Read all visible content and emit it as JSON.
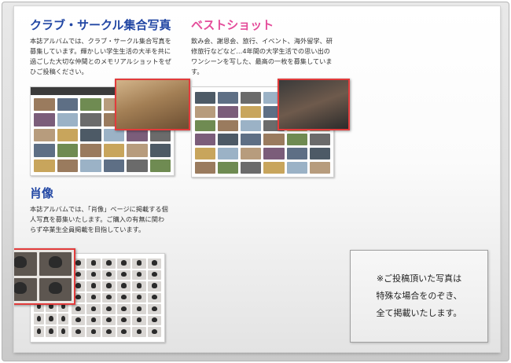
{
  "sections": {
    "club": {
      "title": "クラブ・サークル集合写真",
      "desc": "本誌アルバムでは、クラブ・サークル集合写真を募集しています。輝かしい学生生活の大半を共に過ごした大切な仲間とのメモリアルショットをぜひご投稿ください。"
    },
    "best": {
      "title": "ベストショット",
      "desc": "飲み会、謝恩会、旅行、イベント、海外留学、研修旅行などなど…4年間の大学生活での思い出のワンシーンを写した、最高の一枚を募集しています。"
    },
    "portrait": {
      "title": "肖像",
      "desc": "本誌アルバムでは、「肖像」ページに掲載する個人写真を募集いたします。ご購入の有無に関わらず卒業生全員掲載を目指しています。"
    }
  },
  "note": {
    "line1": "※ご投稿頂いた写真は",
    "line2": "特殊な場合をのぞき、",
    "line3": "全て掲載いたします。"
  },
  "colors": {
    "club_title": "#2247a4",
    "best_title": "#e44c9a",
    "portrait_title": "#2247a4",
    "highlight_border": "#e23b3b"
  }
}
